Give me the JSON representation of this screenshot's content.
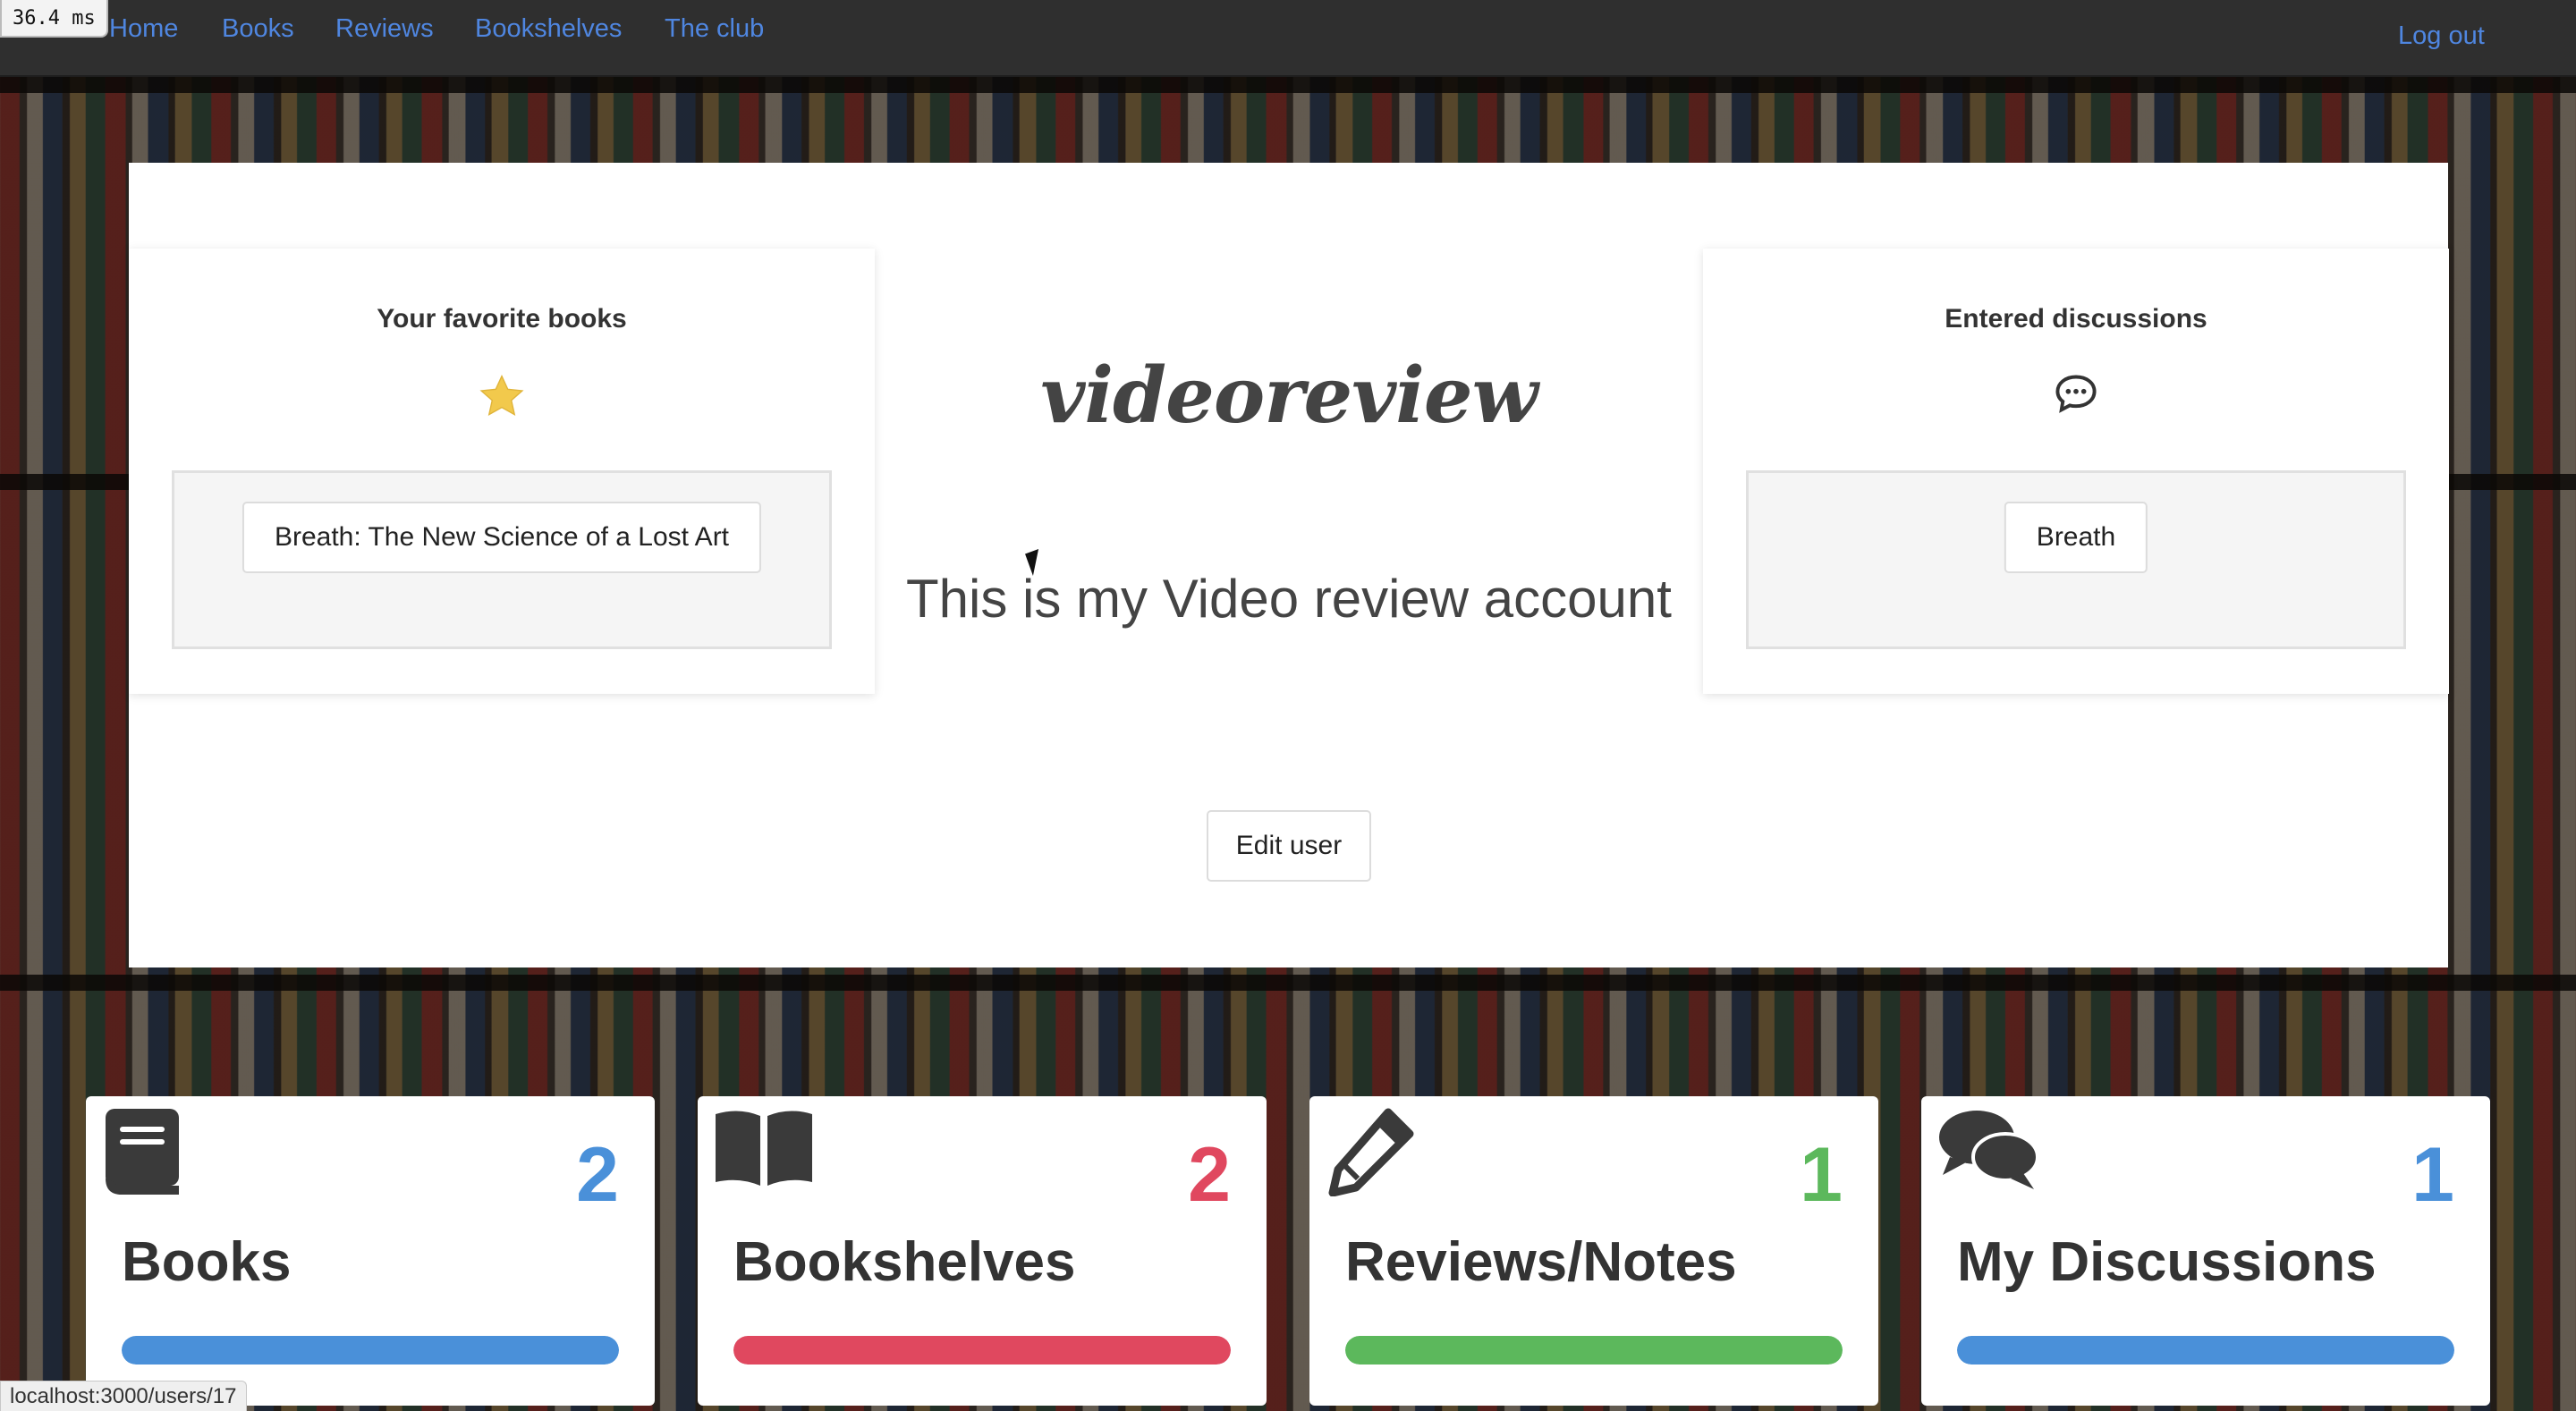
{
  "debug": {
    "timing": "36.4 ms"
  },
  "nav": {
    "links": [
      "Home",
      "Books",
      "Reviews",
      "Bookshelves",
      "The club"
    ],
    "logout": "Log out",
    "link_color": "#4f86e0"
  },
  "profile": {
    "username": "videoreview",
    "bio": "This is my Video review account",
    "edit_label": "Edit user",
    "favorites": {
      "title": "Your favorite books",
      "icon": "star-icon",
      "icon_color": "#f2c94c",
      "items": [
        "Breath: The New Science of a Lost Art"
      ]
    },
    "discussions": {
      "title": "Entered discussions",
      "icon": "comment-dots-icon",
      "items": [
        "Breath"
      ]
    }
  },
  "stats": [
    {
      "label": "Books",
      "count": "2",
      "icon": "book-icon",
      "color": "#4a90d9",
      "progress": 1.0
    },
    {
      "label": "Bookshelves",
      "count": "2",
      "icon": "book-open-icon",
      "color": "#e0485f",
      "progress": 1.0
    },
    {
      "label": "Reviews/Notes",
      "count": "1",
      "icon": "pencil-icon",
      "color": "#5cb85c",
      "progress": 1.0
    },
    {
      "label": "My Discussions",
      "count": "1",
      "icon": "comments-icon",
      "color": "#4a90d9",
      "progress": 1.0
    }
  ],
  "status_url": "localhost:3000/users/17"
}
